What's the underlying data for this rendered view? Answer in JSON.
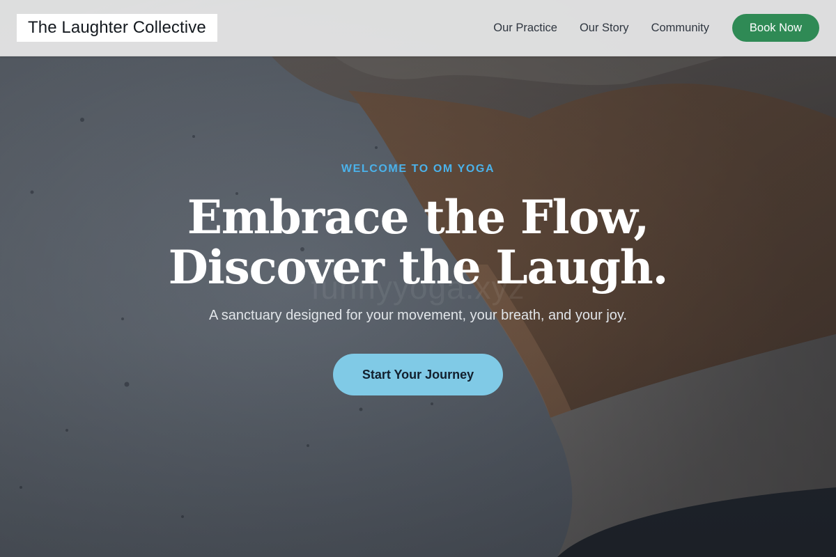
{
  "header": {
    "logo_text": "The Laughter Collective",
    "nav": [
      {
        "label": "Our Practice"
      },
      {
        "label": "Our Story"
      },
      {
        "label": "Community"
      }
    ],
    "book_button": "Book Now"
  },
  "hero": {
    "eyebrow": "WELCOME TO OM YOGA",
    "headline_line1": "Embrace the Flow,",
    "headline_line2": "Discover the Laugh.",
    "subheadline": "A sanctuary designed for your movement, your breath, and your joy.",
    "cta_label": "Start Your Journey",
    "watermark": "funnyyoga.xyz"
  },
  "colors": {
    "accent_green": "#2f8a55",
    "eyebrow_blue": "#4bb2ea",
    "cta_blue": "#80cae6",
    "header_bg": "#e8e8e8"
  }
}
